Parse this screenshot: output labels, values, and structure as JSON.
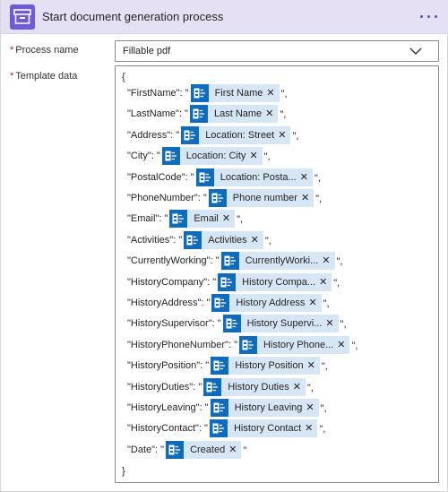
{
  "header": {
    "title": "Start document generation process",
    "icon": "archive-box-icon",
    "accent": "#6f5bd6"
  },
  "process_name": {
    "label": "Process name",
    "required_mark": "*",
    "value": "Fillable pdf"
  },
  "template_data": {
    "label": "Template data",
    "required_mark": "*",
    "open_brace": "{",
    "close_brace": "}",
    "rows": [
      {
        "key": "\"FirstName\": \"",
        "token": "First Name",
        "tail": "\","
      },
      {
        "key": "\"LastName\": \"",
        "token": "Last Name",
        "tail": "\","
      },
      {
        "key": "\"Address\": \"",
        "token": "Location: Street",
        "tail": "\","
      },
      {
        "key": "\"City\": \"",
        "token": "Location: City",
        "tail": "\","
      },
      {
        "key": "\"PostalCode\": \"",
        "token": "Location: Posta...",
        "tail": "\","
      },
      {
        "key": "\"PhoneNumber\": \"",
        "token": "Phone number",
        "tail": "\","
      },
      {
        "key": "\"Email\": \"",
        "token": "Email",
        "tail": "\","
      },
      {
        "key": "\"Activities\": \"",
        "token": "Activities",
        "tail": "\","
      },
      {
        "key": "\"CurrentlyWorking\": \"",
        "token": "CurrentlyWorki...",
        "tail": "\","
      },
      {
        "key": "\"HistoryCompany\": \"",
        "token": "History Compa...",
        "tail": "\","
      },
      {
        "key": "\"HistoryAddress\": \"",
        "token": "History Address",
        "tail": "\","
      },
      {
        "key": "\"HistorySupervisor\": \"",
        "token": "History Supervi...",
        "tail": "\","
      },
      {
        "key": "\"HistoryPhoneNumber\": \"",
        "token": "History Phone...",
        "tail": "\","
      },
      {
        "key": "\"HistoryPosition\": \"",
        "token": "History Position",
        "tail": "\","
      },
      {
        "key": "\"HistoryDuties\": \"",
        "token": "History Duties",
        "tail": "\","
      },
      {
        "key": "\"HistoryLeaving\": \"",
        "token": "History Leaving",
        "tail": "\","
      },
      {
        "key": "\"HistoryContact\": \"",
        "token": "History Contact",
        "tail": "\","
      },
      {
        "key": "\"Date\": \"",
        "token": "Created",
        "tail": "\""
      }
    ],
    "token_remove_glyph": "✕",
    "token_color": "#0f6cbd"
  }
}
